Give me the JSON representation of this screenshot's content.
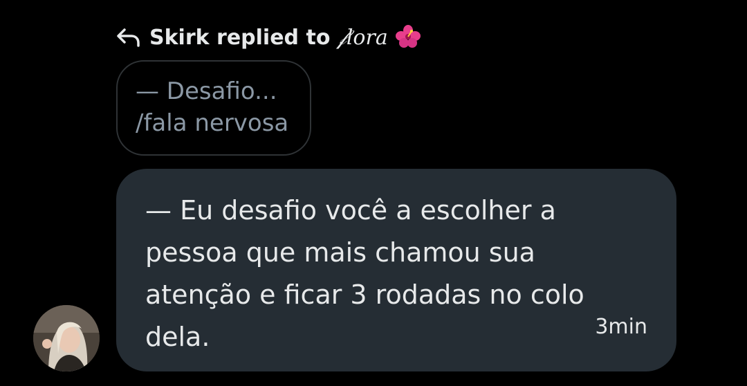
{
  "reply_header": {
    "prefix": "Skirk replied to",
    "target_name": "𝒻lora",
    "emoji_icon": "hibiscus-icon"
  },
  "quoted_message": {
    "lines": [
      "— Desafio...",
      "/fala nervosa"
    ]
  },
  "message": {
    "lines": [
      "— Eu desafio você a escolher a",
      "pessoa que mais chamou sua",
      "atenção e ficar 3 rodadas no colo",
      "dela."
    ],
    "timestamp": "3min"
  },
  "colors": {
    "background": "#000000",
    "bubble": "#252d34",
    "quoted_border": "#2f3336",
    "muted_text": "#8b98a5",
    "text": "#e7e9ea"
  }
}
